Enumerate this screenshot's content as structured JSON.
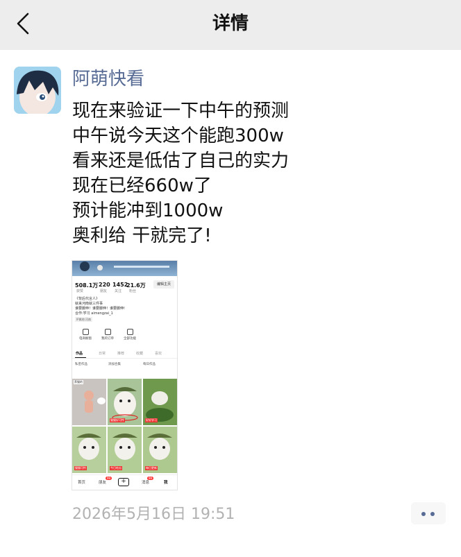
{
  "header": {
    "title": "详情"
  },
  "post": {
    "author": "阿萌快看",
    "lines": [
      "现在来验证一下中午的预测",
      "中午说今天这个能跑300w",
      "看来还是低估了自己的实力",
      "现在已经660w了",
      "预计能冲到1000w",
      "奥利给 干就完了!"
    ],
    "timestamp": "2026年5月16日 19:51"
  },
  "screenshot": {
    "stats": [
      {
        "value": "508.1万",
        "label": "获赞"
      },
      {
        "value": "220",
        "label": "朋友"
      },
      {
        "value": "1452",
        "label": "关注"
      },
      {
        "value": "21.6万",
        "label": "粉丝"
      }
    ],
    "edit_button": "编辑主页",
    "bio": [
      "《背后代言人》",
      "就来河南就三件事",
      "谁要脚伸！谁要脚伸！谁要脚伸!",
      "合作:学习 aimengzai_1"
    ],
    "tag": "IP属地:河南",
    "quick": [
      "电商橱窗",
      "我的订单",
      "全部功能"
    ],
    "tabs": [
      "作品",
      "日常",
      "推荐",
      "收藏",
      "喜欢"
    ],
    "filters": [
      "私密作品",
      "添加合集",
      "每日作品"
    ],
    "cell_badge": "养猫的",
    "cell_captions": [
      "猫猫好可怜",
      "好好学习",
      "猫猫可怜",
      "今日吃瓜",
      "每日更新",
      "猫猫好可怜"
    ],
    "bottom_nav": [
      "首页",
      "朋友",
      "消息",
      "我"
    ],
    "badges": [
      "99",
      "99"
    ]
  },
  "colors": {
    "link": "#576b95",
    "topbar_bg": "#ededed",
    "timestamp": "#b2b2b2"
  },
  "icons": {
    "back": "chevron-left-icon",
    "more": "more-dots-icon"
  }
}
